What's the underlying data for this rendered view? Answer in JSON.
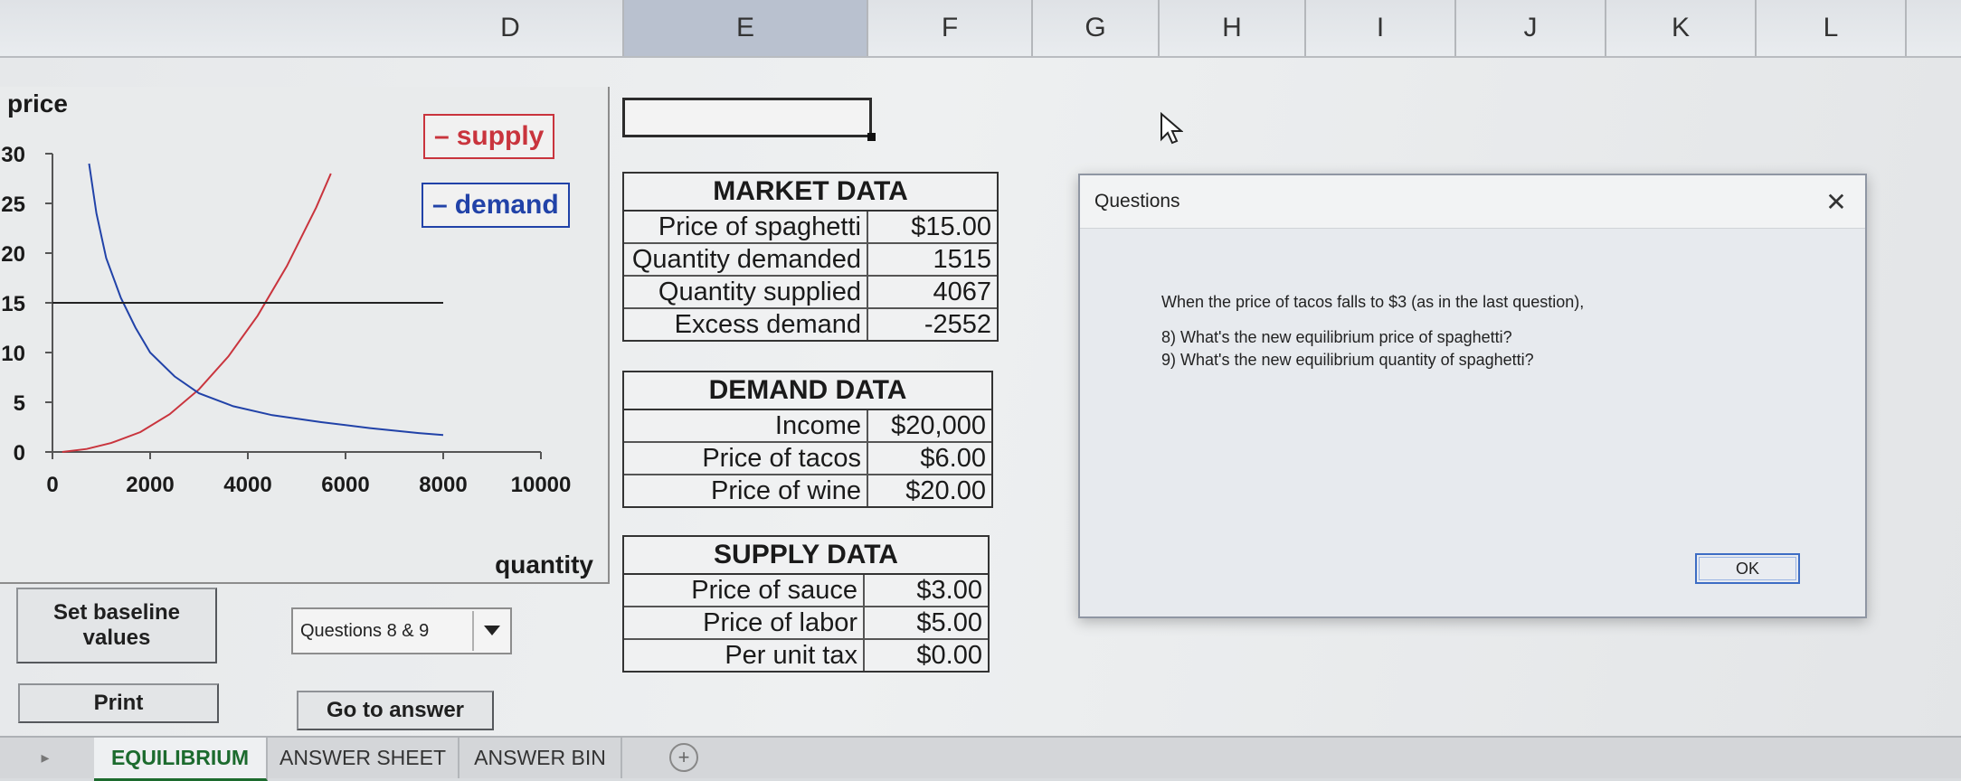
{
  "columns": [
    "D",
    "E",
    "F",
    "G",
    "H",
    "I",
    "J",
    "K",
    "L"
  ],
  "chart": {
    "legend": {
      "supply": "supply",
      "demand": "demand"
    },
    "ylabel": "price",
    "xlabel": "quantity"
  },
  "chart_data": {
    "type": "line",
    "ylabel": "price",
    "xlabel": "quantity",
    "xlim": [
      0,
      10000
    ],
    "ylim": [
      0,
      30
    ],
    "x_ticks": [
      "0",
      "2000",
      "4000",
      "6000",
      "8000",
      "10000"
    ],
    "y_ticks": [
      "0",
      "5",
      "10",
      "15",
      "20",
      "25",
      "30"
    ],
    "series": [
      {
        "name": "supply",
        "color": "#c9343d",
        "x": [
          200,
          700,
          1200,
          1800,
          2400,
          3000,
          3600,
          4200,
          4800,
          5400,
          5700
        ],
        "y": [
          0,
          0.3,
          0.9,
          2.0,
          3.8,
          6.3,
          9.6,
          13.7,
          18.7,
          24.6,
          28.0
        ]
      },
      {
        "name": "demand",
        "color": "#2142a8",
        "x": [
          750,
          900,
          1100,
          1400,
          1700,
          2000,
          2500,
          3000,
          3700,
          4500,
          5500,
          6500,
          7500,
          8000
        ],
        "y": [
          29.0,
          24.0,
          19.5,
          15.5,
          12.5,
          10.0,
          7.6,
          5.9,
          4.6,
          3.7,
          3.0,
          2.4,
          1.9,
          1.7
        ]
      },
      {
        "name": "",
        "color": "#222222",
        "x": [
          0,
          8000
        ],
        "y": [
          15.0,
          15.0
        ]
      }
    ]
  },
  "buttons": {
    "baseline": "Set baseline values",
    "print": "Print",
    "goto": "Go to answer"
  },
  "combo": {
    "value": "Questions 8 & 9"
  },
  "market": {
    "title": "MARKET DATA",
    "rows": [
      {
        "label": "Price of spaghetti",
        "value": "$15.00"
      },
      {
        "label": "Quantity demanded",
        "value": "1515"
      },
      {
        "label": "Quantity supplied",
        "value": "4067"
      },
      {
        "label": "Excess demand",
        "value": "-2552"
      }
    ]
  },
  "demand_data": {
    "title": "DEMAND DATA",
    "rows": [
      {
        "label": "Income",
        "value": "$20,000"
      },
      {
        "label": "Price of tacos",
        "value": "$6.00"
      },
      {
        "label": "Price of wine",
        "value": "$20.00"
      }
    ]
  },
  "supply_data": {
    "title": "SUPPLY DATA",
    "rows": [
      {
        "label": "Price of sauce",
        "value": "$3.00"
      },
      {
        "label": "Price of labor",
        "value": "$5.00"
      },
      {
        "label": "Per unit tax",
        "value": "$0.00"
      }
    ]
  },
  "dialog": {
    "title": "Questions",
    "intro": "When the price of tacos falls to $3 (as in the last question),",
    "q8": "8)  What's the new equilibrium price of spaghetti?",
    "q9": "9)  What's the new equilibrium quantity of spaghetti?",
    "ok": "OK"
  },
  "tabs": [
    "EQUILIBRIUM",
    "ANSWER SHEET",
    "ANSWER BIN"
  ]
}
